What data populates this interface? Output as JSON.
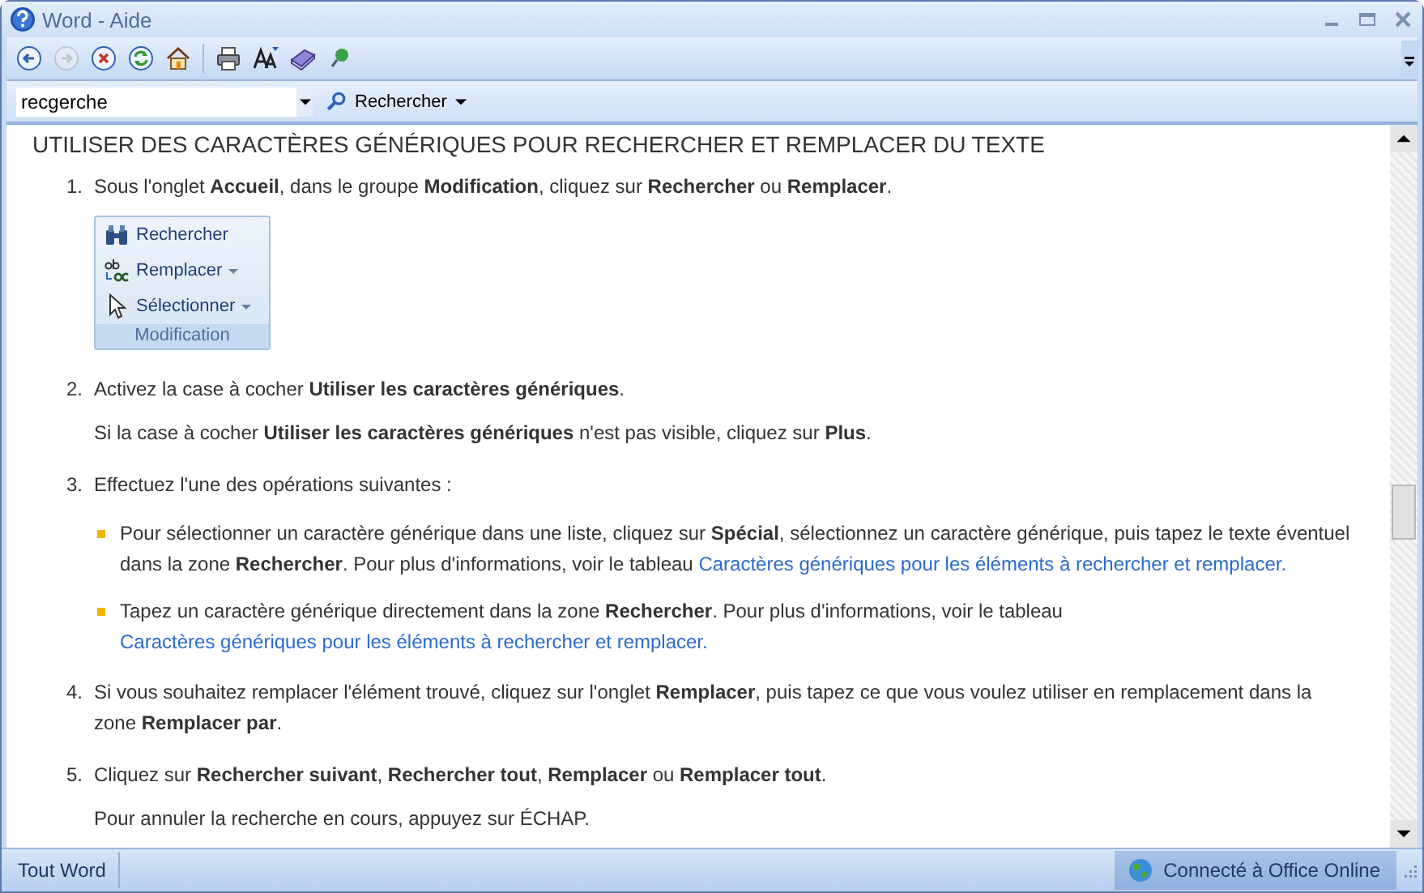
{
  "window": {
    "title": "Word - Aide"
  },
  "toolbar": {
    "buttons": [
      {
        "kind": "back",
        "disabled": false
      },
      {
        "kind": "forward",
        "disabled": true
      },
      {
        "kind": "stop",
        "disabled": false
      },
      {
        "kind": "refresh",
        "disabled": false
      },
      {
        "kind": "home",
        "disabled": false
      },
      {
        "kind": "print",
        "disabled": false
      },
      {
        "kind": "font-size",
        "disabled": false
      },
      {
        "kind": "book",
        "disabled": false
      },
      {
        "kind": "pin",
        "disabled": false
      }
    ]
  },
  "search": {
    "value": "recgerche",
    "button": "Rechercher"
  },
  "article": {
    "title": "UTILISER DES CARACTÈRES GÉNÉRIQUES POUR RECHERCHER ET REMPLACER DU TEXTE",
    "steps": [
      {
        "number": "1.",
        "blocks": [
          {
            "kind": "text",
            "text": "Sous l'onglet **Accueil**, dans le groupe **Modification**, cliquez sur **Rechercher** ou **Remplacer**."
          },
          {
            "kind": "ribbon",
            "items": [
              {
                "label": "Rechercher",
                "dropdown": false
              },
              {
                "label": "Remplacer",
                "dropdown": true
              },
              {
                "label": "Sélectionner",
                "dropdown": true
              }
            ],
            "group": "Modification"
          }
        ]
      },
      {
        "number": "2.",
        "blocks": [
          {
            "kind": "text",
            "text": "Activez la case à cocher **Utiliser les caractères génériques**."
          },
          {
            "kind": "text",
            "text": "Si la case à cocher **Utiliser les caractères génériques** n'est pas visible, cliquez sur **Plus**."
          }
        ]
      },
      {
        "number": "3.",
        "blocks": [
          {
            "kind": "text",
            "text": "Effectuez l'une des opérations suivantes :"
          },
          {
            "kind": "bullets",
            "items": [
              {
                "text": "Pour sélectionner un caractère générique dans une liste, cliquez sur **Spécial**, sélectionnez un caractère générique, puis tapez le texte éventuel dans la zone **Rechercher**. Pour plus d'informations, voir le tableau",
                "link": "Caractères génériques pour les éléments à rechercher et remplacer."
              },
              {
                "text": "Tapez un caractère générique directement dans la zone **Rechercher**. Pour plus d'informations, voir le tableau",
                "link": "Caractères génériques pour les éléments à rechercher et remplacer."
              }
            ]
          }
        ]
      },
      {
        "number": "4.",
        "blocks": [
          {
            "kind": "text",
            "text": "Si vous souhaitez remplacer l'élément trouvé, cliquez sur l'onglet **Remplacer**, puis tapez ce que vous voulez utiliser en remplacement dans la zone **Remplacer par**."
          }
        ]
      },
      {
        "number": "5.",
        "blocks": [
          {
            "kind": "text",
            "text": "Cliquez sur **Rechercher suivant**, **Rechercher tout**, **Remplacer** ou **Remplacer tout**."
          },
          {
            "kind": "text",
            "text": "Pour annuler la recherche en cours, appuyez sur ÉCHAP."
          }
        ]
      }
    ]
  },
  "status_bar": {
    "scope": "Tout Word",
    "connection": "Connecté à Office Online"
  }
}
